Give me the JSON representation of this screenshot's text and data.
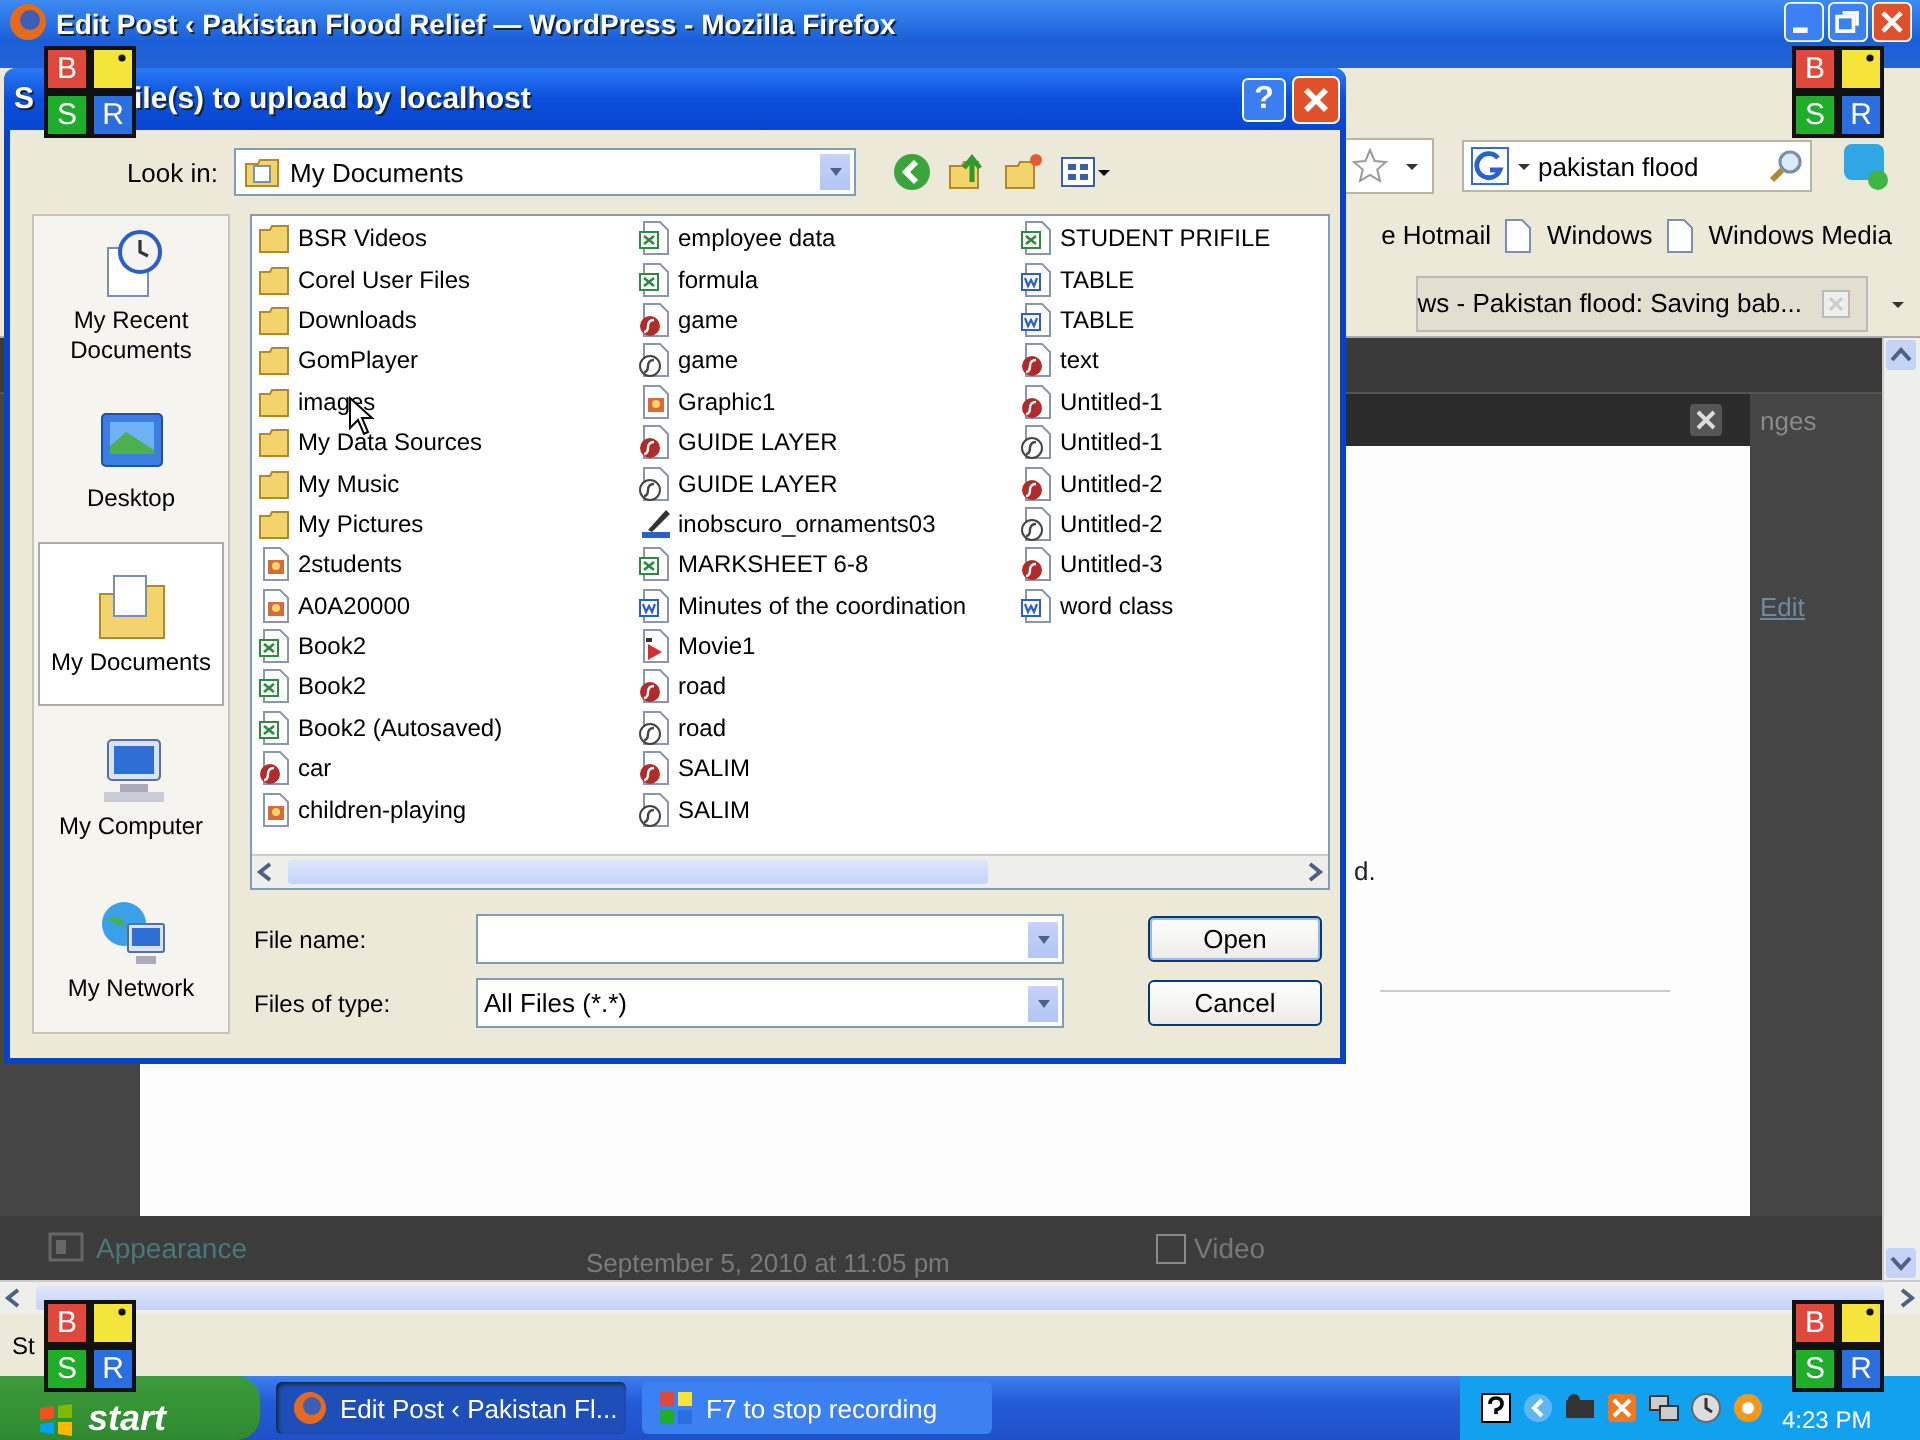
{
  "browser": {
    "title": "Edit Post ‹ Pakistan Flood Relief — WordPress - Mozilla Firefox",
    "search": {
      "value": "pakistan flood"
    },
    "bookmarks": [
      "e Hotmail",
      "Windows",
      "Windows Media"
    ],
    "tab": {
      "label": "ws - Pakistan flood: Saving bab..."
    },
    "status": "St"
  },
  "page": {
    "side_text": "nges",
    "edit_link": "Edit",
    "note": "d.",
    "menu_item": "Appearance",
    "date": "September 5, 2010 at 11:05 pm",
    "checkbox": {
      "label": "Video",
      "checked": false
    }
  },
  "dialog": {
    "title": "S",
    "title_rest": "ile(s) to upload by localhost",
    "help": "?",
    "look_in_label": "Look in:",
    "look_in": "My Documents",
    "places": [
      {
        "label": "My Recent Documents",
        "kind": "recent",
        "selected": false
      },
      {
        "label": "Desktop",
        "kind": "desktop",
        "selected": false
      },
      {
        "label": "My Documents",
        "kind": "documents",
        "selected": true
      },
      {
        "label": "My Computer",
        "kind": "computer",
        "selected": false
      },
      {
        "label": "My Network",
        "kind": "network",
        "selected": false
      }
    ],
    "files": [
      {
        "name": "BSR Videos",
        "kind": "folder"
      },
      {
        "name": "Corel User Files",
        "kind": "folder"
      },
      {
        "name": "Downloads",
        "kind": "folder"
      },
      {
        "name": "GomPlayer",
        "kind": "folder"
      },
      {
        "name": "images",
        "kind": "folder"
      },
      {
        "name": "My Data Sources",
        "kind": "folder"
      },
      {
        "name": "My Music",
        "kind": "folder"
      },
      {
        "name": "My Pictures",
        "kind": "folder"
      },
      {
        "name": "2students",
        "kind": "image"
      },
      {
        "name": "A0A20000",
        "kind": "image"
      },
      {
        "name": "Book2",
        "kind": "sheet"
      },
      {
        "name": "Book2",
        "kind": "sheet"
      },
      {
        "name": "Book2 (Autosaved)",
        "kind": "sheet"
      },
      {
        "name": "car",
        "kind": "swf"
      },
      {
        "name": "children-playing",
        "kind": "image"
      },
      {
        "name": "employee data",
        "kind": "sheet"
      },
      {
        "name": "formula",
        "kind": "sheet"
      },
      {
        "name": "game",
        "kind": "swf"
      },
      {
        "name": "game",
        "kind": "fla"
      },
      {
        "name": "Graphic1",
        "kind": "image"
      },
      {
        "name": "GUIDE LAYER",
        "kind": "swf"
      },
      {
        "name": "GUIDE LAYER",
        "kind": "fla"
      },
      {
        "name": "inobscuro_ornaments03",
        "kind": "draw"
      },
      {
        "name": "MARKSHEET 6-8",
        "kind": "sheet"
      },
      {
        "name": "Minutes of the coordination",
        "kind": "doc"
      },
      {
        "name": "Movie1",
        "kind": "movie"
      },
      {
        "name": "road",
        "kind": "swf"
      },
      {
        "name": "road",
        "kind": "fla"
      },
      {
        "name": "SALIM",
        "kind": "swf"
      },
      {
        "name": "SALIM",
        "kind": "fla"
      },
      {
        "name": "STUDENT PRIFILE",
        "kind": "sheet"
      },
      {
        "name": "TABLE",
        "kind": "doc"
      },
      {
        "name": "TABLE",
        "kind": "doc"
      },
      {
        "name": "text",
        "kind": "swf"
      },
      {
        "name": "Untitled-1",
        "kind": "swf"
      },
      {
        "name": "Untitled-1",
        "kind": "fla"
      },
      {
        "name": "Untitled-2",
        "kind": "swf"
      },
      {
        "name": "Untitled-2",
        "kind": "fla"
      },
      {
        "name": "Untitled-3",
        "kind": "swf"
      },
      {
        "name": "word class",
        "kind": "doc"
      }
    ],
    "file_name_label": "File name:",
    "type_label": "Files of type:",
    "type_value": "All Files (*.*)",
    "buttons": [
      "Open",
      "Cancel"
    ]
  },
  "recorder_overlays": [
    [
      "B",
      "S",
      "R"
    ],
    [
      "B",
      "S",
      "R"
    ],
    [
      "B",
      "S",
      "R"
    ],
    [
      "B",
      "S",
      "R"
    ]
  ],
  "taskbar": {
    "start": "start",
    "tasks": [
      {
        "label": "Edit Post ‹ Pakistan Fl...",
        "kind": "firefox",
        "selected": true
      },
      {
        "label": "F7 to stop recording",
        "kind": "recorder",
        "selected": false
      }
    ],
    "clock": "4:23 PM"
  }
}
